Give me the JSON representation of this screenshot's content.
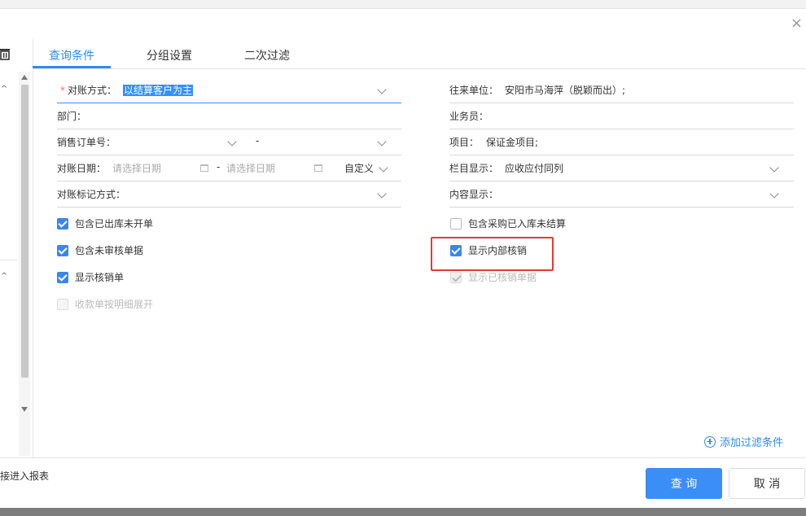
{
  "tabs": [
    {
      "label": "查询条件"
    },
    {
      "label": "分组设置"
    },
    {
      "label": "二次过滤"
    }
  ],
  "form": {
    "reconcile_method": {
      "label": "对账方式：",
      "value": "以结算客户为主"
    },
    "department": {
      "label": "部门："
    },
    "sales_order": {
      "label": "销售订单号：",
      "separator": "-"
    },
    "reconcile_date": {
      "label": "对账日期：",
      "start_placeholder": "请选择日期",
      "end_placeholder": "请选择日期",
      "separator": "-",
      "preset": "自定义"
    },
    "mark_method": {
      "label": "对账标记方式："
    },
    "partner": {
      "label": "往来单位：",
      "value": "安阳市马海萍（脱颖而出）;"
    },
    "salesperson": {
      "label": "业务员："
    },
    "project": {
      "label": "项目：",
      "value": "保证金项目;"
    },
    "column_display": {
      "label": "栏目显示：",
      "value": "应收应付同列"
    },
    "content_display": {
      "label": "内容显示："
    }
  },
  "checkboxes_left": [
    {
      "label": "包含已出库未开单",
      "state": "checked"
    },
    {
      "label": "包含未审核单据",
      "state": "checked"
    },
    {
      "label": "显示核销单",
      "state": "checked"
    },
    {
      "label": "收款单按明细展开",
      "state": "disabled"
    }
  ],
  "checkboxes_right": [
    {
      "label": "包含采购已入库未结算",
      "state": "unchecked"
    },
    {
      "label": "显示内部核销",
      "state": "checked"
    },
    {
      "label": "显示已核销单据",
      "state": "checked-disabled"
    }
  ],
  "add_filter_label": "添加过滤条件",
  "footer": {
    "left_text": "接进入报表",
    "query_button": "查 询",
    "cancel_button": "取 消"
  },
  "colors": {
    "accent": "#2e8bf0",
    "highlight": "#e53935"
  }
}
